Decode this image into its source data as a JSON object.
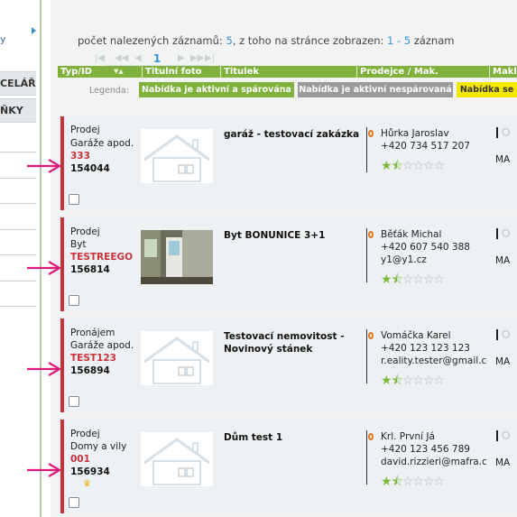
{
  "sidebar": {
    "partial_text": "y",
    "tab1": "CELÁŘ",
    "tab2": "ŇKY"
  },
  "summary": {
    "prefix": "počet nalezených záznamů:",
    "total": "5",
    "middle": ", z toho na stránce zobrazen:",
    "range": "1 - 5",
    "suffix": "záznam"
  },
  "pager": {
    "current_page": "1"
  },
  "header": {
    "col_type": "Typ/ID",
    "col_photo": "Titulní foto",
    "col_title": "Titulek",
    "col_seller": "Prodejce / Mak.",
    "col_broker": "Makle"
  },
  "legend": {
    "label": "Legenda:",
    "item1": "Nabídka je aktivní a spárována",
    "item2": "Nabídka je aktivní nespárovaná",
    "item3": "Nabídka se",
    "color1": "#7fb13c",
    "color2": "#9a9a9a",
    "color3": "#f5e800"
  },
  "rows": [
    {
      "deal": "Prodej",
      "type": "Garáže apod.",
      "code": "333",
      "id": "154044",
      "title": "garáž - testovací zakázka",
      "title2": "",
      "agent": "Hůrka Jaroslav",
      "phone": "+420 734 517 207",
      "email": "",
      "right": "MA",
      "has_photo": false
    },
    {
      "deal": "Prodej",
      "type": "Byt",
      "code": "TESTREEGO",
      "id": "156814",
      "title": "Byt BONUNICE 3+1",
      "title2": "",
      "agent": "Běťák Michal",
      "phone": "+420 607 540 388",
      "email": "y1@y1.cz",
      "right": "MA",
      "has_photo": true
    },
    {
      "deal": "Pronájem",
      "type": "Garáže apod.",
      "code": "TEST123",
      "id": "156894",
      "title": "Testovací nemovitost -",
      "title2": "Novinový stánek",
      "agent": "Vomáčka Karel",
      "phone": "+420 123 123 123",
      "email": "r.eality.tester@gmail.cor",
      "right": "MA",
      "has_photo": false
    },
    {
      "deal": "Prodej",
      "type": "Domy a vily",
      "code": "001",
      "id": "156934",
      "title": "Dům test 1",
      "title2": "",
      "agent": "Krl. První Já",
      "phone": "+420 123 456 789",
      "email": "david.rizzieri@mafra.cz",
      "right": "MA",
      "has_photo": false
    }
  ],
  "accent": {
    "red": "#c9313a",
    "blue": "#3a8fd0",
    "pink_arrow": "#e0187a"
  }
}
